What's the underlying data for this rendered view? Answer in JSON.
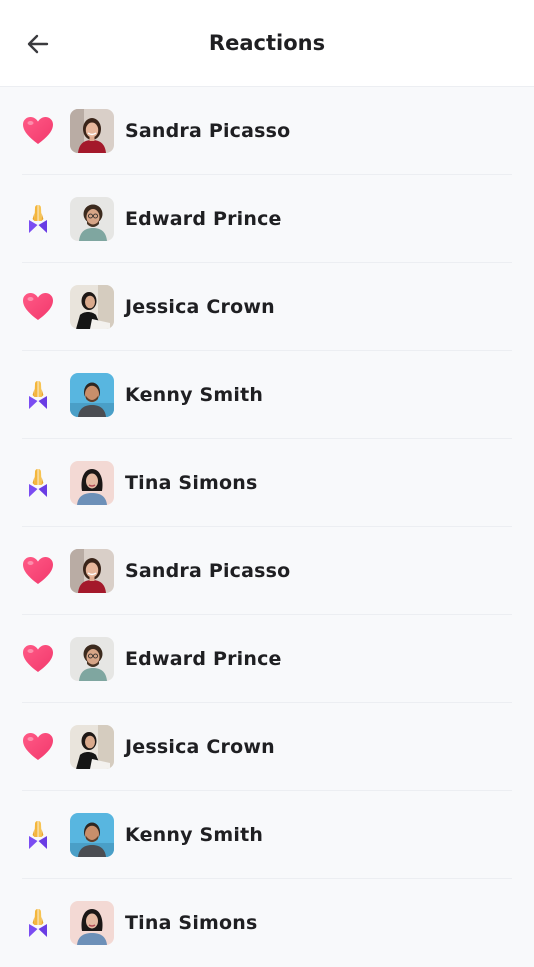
{
  "header": {
    "title": "Reactions",
    "back_icon": "arrow-left-icon"
  },
  "colors": {
    "heart": "#f2386c",
    "hands_yellow": "#f4b63b",
    "hands_purple": "#7b4df2",
    "text": "#1f1f22",
    "divider": "#eceef2",
    "background": "#f8f9fb"
  },
  "reactions": [
    {
      "name": "Sandra Picasso",
      "reaction": "heart",
      "avatar": "sandra"
    },
    {
      "name": "Edward Prince",
      "reaction": "praying-hands",
      "avatar": "edward"
    },
    {
      "name": "Jessica Crown",
      "reaction": "heart",
      "avatar": "jessica"
    },
    {
      "name": "Kenny Smith",
      "reaction": "praying-hands",
      "avatar": "kenny"
    },
    {
      "name": "Tina Simons",
      "reaction": "praying-hands",
      "avatar": "tina"
    },
    {
      "name": "Sandra Picasso",
      "reaction": "heart",
      "avatar": "sandra"
    },
    {
      "name": "Edward Prince",
      "reaction": "heart",
      "avatar": "edward"
    },
    {
      "name": "Jessica Crown",
      "reaction": "heart",
      "avatar": "jessica"
    },
    {
      "name": "Kenny Smith",
      "reaction": "praying-hands",
      "avatar": "kenny"
    },
    {
      "name": "Tina Simons",
      "reaction": "praying-hands",
      "avatar": "tina"
    }
  ]
}
